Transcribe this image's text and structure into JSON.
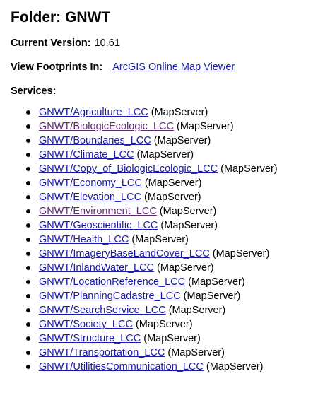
{
  "folder": {
    "title": "Folder: GNWT"
  },
  "current_version": {
    "label": "Current Version:",
    "value": "10.61"
  },
  "view_footprints": {
    "label": "View Footprints In:",
    "link_text": "ArcGIS Online Map Viewer"
  },
  "services": {
    "heading": "Services:",
    "items": [
      {
        "name": "GNWT/Agriculture_LCC",
        "type": "(MapServer)",
        "visited": false
      },
      {
        "name": "GNWT/BiologicEcologic_LCC",
        "type": "(MapServer)",
        "visited": true
      },
      {
        "name": "GNWT/Boundaries_LCC",
        "type": "(MapServer)",
        "visited": false
      },
      {
        "name": "GNWT/Climate_LCC",
        "type": "(MapServer)",
        "visited": false
      },
      {
        "name": "GNWT/Copy_of_BiologicEcologic_LCC",
        "type": "(MapServer)",
        "visited": false
      },
      {
        "name": "GNWT/Economy_LCC",
        "type": "(MapServer)",
        "visited": false
      },
      {
        "name": "GNWT/Elevation_LCC",
        "type": "(MapServer)",
        "visited": false
      },
      {
        "name": "GNWT/Environment_LCC",
        "type": "(MapServer)",
        "visited": true
      },
      {
        "name": "GNWT/Geoscientific_LCC",
        "type": "(MapServer)",
        "visited": false
      },
      {
        "name": "GNWT/Health_LCC",
        "type": "(MapServer)",
        "visited": false
      },
      {
        "name": "GNWT/ImageryBaseLandCover_LCC",
        "type": "(MapServer)",
        "visited": false
      },
      {
        "name": "GNWT/InlandWater_LCC",
        "type": "(MapServer)",
        "visited": false
      },
      {
        "name": "GNWT/LocationReference_LCC",
        "type": "(MapServer)",
        "visited": false
      },
      {
        "name": "GNWT/PlanningCadastre_LCC",
        "type": "(MapServer)",
        "visited": false
      },
      {
        "name": "GNWT/SearchService_LCC",
        "type": "(MapServer)",
        "visited": false
      },
      {
        "name": "GNWT/Society_LCC",
        "type": "(MapServer)",
        "visited": false
      },
      {
        "name": "GNWT/Structure_LCC",
        "type": "(MapServer)",
        "visited": false
      },
      {
        "name": "GNWT/Transportation_LCC",
        "type": "(MapServer)",
        "visited": false
      },
      {
        "name": "GNWT/UtilitiesCommunication_LCC",
        "type": "(MapServer)",
        "visited": false
      }
    ]
  },
  "colors": {
    "link": "#1a1aa6",
    "visited_link": "#5b2a6e",
    "text": "#000000",
    "background": "#ffffff"
  }
}
